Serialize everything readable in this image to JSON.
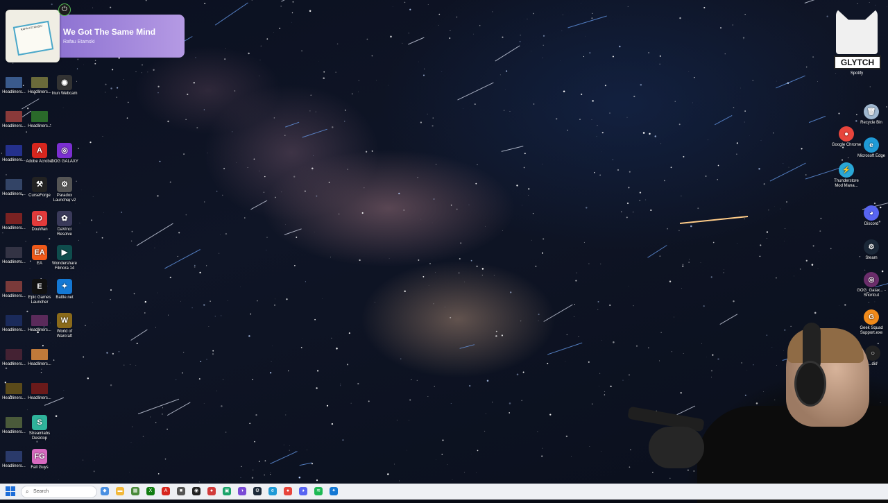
{
  "media": {
    "song_title": "We Got The Same Mind",
    "artist": "Rafau Etamski",
    "album_text": "RAFAU ETAMSKI"
  },
  "stream_logo": {
    "text": "GLYTCH",
    "label": "Spotify"
  },
  "desktop_left": [
    {
      "label": "Headliners...",
      "color": "#3a5a8c"
    },
    {
      "label": "Headliners...",
      "color": "#6a6a3a"
    },
    {
      "label": "Inun Webcam",
      "color": "#333333",
      "glyph": "◉"
    },
    {
      "label": "Headliners...",
      "color": "#8a3a3a"
    },
    {
      "label": "Headliners...",
      "color": "#2a6a2a"
    },
    {
      "label": "Headliners...",
      "color": "#24308c"
    },
    {
      "label": "Adobe Acrobat",
      "color": "#d7261e",
      "glyph": "A"
    },
    {
      "label": "GOG GALAXY",
      "color": "#7b2fd1",
      "glyph": "◎"
    },
    {
      "label": "Headliners...",
      "color": "#334466"
    },
    {
      "label": "CurseForge",
      "color": "#222222",
      "glyph": "⚒"
    },
    {
      "label": "Paradox Launcher v2",
      "color": "#555555",
      "glyph": "⚙"
    },
    {
      "label": "Headliners...",
      "color": "#7a2222"
    },
    {
      "label": "DouWan",
      "color": "#e33b3b",
      "glyph": "D"
    },
    {
      "label": "DaVinci Resolve",
      "color": "#3a3a5a",
      "glyph": "✿"
    },
    {
      "label": "Headliners...",
      "color": "#333344"
    },
    {
      "label": "EA",
      "color": "#f05a1a",
      "glyph": "EA"
    },
    {
      "label": "Wondershare Filmora 14",
      "color": "#0f4d4d",
      "glyph": "▶"
    },
    {
      "label": "Headliners...",
      "color": "#7a3a3a"
    },
    {
      "label": "Epic Games Launcher",
      "color": "#111111",
      "glyph": "E"
    },
    {
      "label": "Battle.net",
      "color": "#1478d4",
      "glyph": "✦"
    },
    {
      "label": "Headliners...",
      "color": "#1a2a5a"
    },
    {
      "label": "Headliners...",
      "color": "#5a2a5a"
    },
    {
      "label": "World of Warcraft",
      "color": "#8a6a1a",
      "glyph": "W"
    },
    {
      "label": "Headliners...",
      "color": "#442233"
    },
    {
      "label": "Headliners...",
      "color": "#c07a3a"
    },
    {
      "label": "Headliners...",
      "color": "#5a4a1a"
    },
    {
      "label": "Headliners...",
      "color": "#6a1a1a"
    },
    {
      "label": "Headliners...",
      "color": "#4a5a3a"
    },
    {
      "label": "Streamlabs Desktop",
      "color": "#2fb39b",
      "glyph": "S"
    },
    {
      "label": "Headliners...",
      "color": "#2a3a6a"
    },
    {
      "label": "Fall Guys",
      "color": "#d86ac0",
      "glyph": "FG"
    }
  ],
  "desktop_right": [
    {
      "label": "Recycle Bin",
      "color": "#a0b8d0",
      "glyph": "🗑"
    },
    {
      "label": "Google Chrome",
      "color": "#e8453c",
      "glyph": "●"
    },
    {
      "label": "Microsoft Edge",
      "color": "#1f9ad6",
      "glyph": "e"
    },
    {
      "label": "Thunderstore Mod Mana...",
      "color": "#2aa7d6",
      "glyph": "⚡"
    },
    {
      "label": "Discord",
      "color": "#5865f2",
      "glyph": "◕"
    },
    {
      "label": "Steam",
      "color": "#1b2838",
      "glyph": "⚙"
    },
    {
      "label": "GOG_Galax... - Shortcut",
      "color": "#6b2d6b",
      "glyph": "◎"
    },
    {
      "label": "Geek Squad Support.exe",
      "color": "#f08a1a",
      "glyph": "G"
    },
    {
      "label": "...dio",
      "color": "#222222",
      "glyph": "○"
    }
  ],
  "taskbar": {
    "search_placeholder": "Search",
    "apps": [
      {
        "name": "copilot",
        "color": "#4a90e2",
        "glyph": "◆"
      },
      {
        "name": "file-explorer",
        "color": "#f2b83a",
        "glyph": "▬"
      },
      {
        "name": "minecraft",
        "color": "#4a8a3a",
        "glyph": "▦"
      },
      {
        "name": "xbox",
        "color": "#107c10",
        "glyph": "X"
      },
      {
        "name": "adobe",
        "color": "#d7261e",
        "glyph": "A"
      },
      {
        "name": "app-grey",
        "color": "#555555",
        "glyph": "■"
      },
      {
        "name": "obs",
        "color": "#222222",
        "glyph": "◉"
      },
      {
        "name": "app-multi",
        "color": "#d23b3b",
        "glyph": "●"
      },
      {
        "name": "app-green",
        "color": "#1aa36a",
        "glyph": "▣"
      },
      {
        "name": "app-purple",
        "color": "#7a4ad6",
        "glyph": "◑"
      },
      {
        "name": "steam",
        "color": "#1b2838",
        "glyph": "⚙"
      },
      {
        "name": "edge",
        "color": "#1f9ad6",
        "glyph": "e"
      },
      {
        "name": "chrome",
        "color": "#e8453c",
        "glyph": "●"
      },
      {
        "name": "discord",
        "color": "#5865f2",
        "glyph": "◕"
      },
      {
        "name": "spotify",
        "color": "#1db954",
        "glyph": "≋"
      },
      {
        "name": "battle-net",
        "color": "#1478d4",
        "glyph": "✦"
      }
    ]
  }
}
